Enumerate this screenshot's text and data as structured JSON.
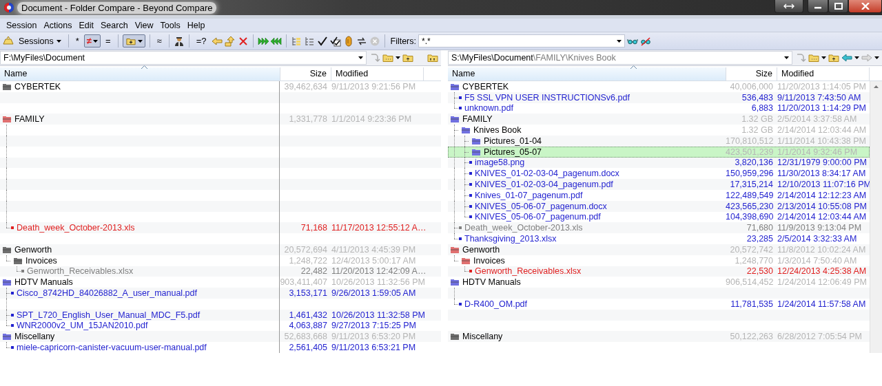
{
  "window": {
    "title": "Document - Folder Compare - Beyond Compare"
  },
  "menu": [
    "Session",
    "Actions",
    "Edit",
    "Search",
    "View",
    "Tools",
    "Help"
  ],
  "toolbar": {
    "sessions": "Sessions",
    "text_buttons": [
      {
        "label": "*",
        "pressed": false
      },
      {
        "label": "≠",
        "pressed": true
      },
      {
        "label": "=",
        "pressed": false
      },
      {
        "label": "≈",
        "pressed": false
      },
      {
        "label": "=?",
        "pressed": false
      }
    ],
    "folder_toggle": {
      "pressed": true
    },
    "filters_label": "Filters:",
    "filter_value": "*.*"
  },
  "left": {
    "path": "F:\\MyFiles\\Document",
    "columns": [
      "Name",
      "Size",
      "Modified"
    ],
    "items": [
      {
        "kind": "folder",
        "name": "CYBERTEK",
        "size": "39,462,634",
        "modified": "9/11/2013 9:21:56 PM",
        "color": "#6e6e6e",
        "selected": false
      },
      {
        "kind": "gap"
      },
      {
        "kind": "gap"
      },
      {
        "kind": "folder",
        "name": "FAMILY",
        "size": "1,331,778",
        "modified": "1/1/2014 9:23:36 PM",
        "color": "#e07070",
        "selected": false,
        "children": [
          {
            "kind": "gap"
          },
          {
            "kind": "gap"
          },
          {
            "kind": "gap"
          },
          {
            "kind": "gap"
          },
          {
            "kind": "gap"
          },
          {
            "kind": "gap"
          },
          {
            "kind": "gap"
          },
          {
            "kind": "gap"
          },
          {
            "kind": "gap"
          },
          {
            "kind": "file",
            "name": "Death_week_October-2013.xls",
            "size": "71,168",
            "modified": "11/17/2013 12:55:12 A…",
            "color": "#e02020",
            "selected": false
          }
        ]
      },
      {
        "kind": "gap"
      },
      {
        "kind": "folder",
        "name": "Genworth",
        "size": "20,572,694",
        "modified": "4/11/2013 4:45:39 PM",
        "color": "#6e6e6e",
        "selected": false,
        "children": [
          {
            "kind": "folder",
            "name": "Invoices",
            "size": "1,248,722",
            "modified": "12/4/2013 5:00:17 AM",
            "color": "#6e6e6e",
            "selected": false,
            "children": [
              {
                "kind": "file",
                "name": "Genworth_Receivables.xlsx",
                "size": "22,482",
                "modified": "11/20/2013 12:42:09 A…",
                "color": "#808080",
                "selected": false
              }
            ]
          }
        ]
      },
      {
        "kind": "folder",
        "name": "HDTV Manuals",
        "size": "903,411,407",
        "modified": "10/26/2013 11:32:56 PM",
        "color": "#7070e0",
        "selected": false,
        "children": [
          {
            "kind": "file",
            "name": "Cisco_8742HD_84026882_A_user_manual.pdf",
            "size": "3,153,171",
            "modified": "9/26/2013 1:59:05 AM",
            "color": "#2323d0",
            "selected": false
          },
          {
            "kind": "gap"
          },
          {
            "kind": "file",
            "name": "SPT_L720_English_User_Manual_MDC_F5.pdf",
            "size": "1,461,432",
            "modified": "10/26/2013 11:32:58 PM",
            "color": "#2323d0",
            "selected": false
          },
          {
            "kind": "file",
            "name": "WNR2000v2_UM_15JAN2010.pdf",
            "size": "4,063,887",
            "modified": "9/27/2013 7:15:25 PM",
            "color": "#2323d0",
            "selected": false
          }
        ]
      },
      {
        "kind": "folder",
        "name": "Miscellany",
        "size": "52,683,668",
        "modified": "9/11/2013 6:53:20 PM",
        "color": "#7070e0",
        "selected": false,
        "children": [
          {
            "kind": "file",
            "name": "miele-capricorn-canister-vacuum-user-manual.pdf",
            "size": "2,561,405",
            "modified": "9/11/2013 6:53:21 PM",
            "color": "#2323d0",
            "selected": false
          }
        ]
      }
    ]
  },
  "right": {
    "path": "S:\\MyFiles\\Document",
    "path_extra": "\\FAMILY\\Knives Book",
    "columns": [
      "Name",
      "Size",
      "Modified"
    ],
    "items": [
      {
        "kind": "folder",
        "name": "CYBERTEK",
        "size": "40,006,000",
        "modified": "11/20/2013 1:14:05 PM",
        "color": "#7070e0",
        "selected": false,
        "children": [
          {
            "kind": "file",
            "name": "F5 SSL VPN USER INSTRUCTIONSv6.pdf",
            "size": "536,483",
            "modified": "9/11/2013 7:43:50 AM",
            "color": "#2323d0",
            "selected": false
          },
          {
            "kind": "file",
            "name": "unknown.pdf",
            "size": "6,883",
            "modified": "11/20/2013 1:14:29 PM",
            "color": "#2323d0",
            "selected": false
          }
        ]
      },
      {
        "kind": "folder",
        "name": "FAMILY",
        "size": "1.32 GB",
        "modified": "2/5/2014 3:37:58 AM",
        "color": "#7070e0",
        "selected": false,
        "children": [
          {
            "kind": "folder",
            "name": "Knives Book",
            "size": "1.32 GB",
            "modified": "2/14/2014 12:03:44 AM",
            "color": "#7070e0",
            "selected": false,
            "children": [
              {
                "kind": "folder",
                "name": "Pictures_01-04",
                "size": "170,810,512",
                "modified": "1/11/2014 10:43:38 PM",
                "color": "#7070e0",
                "selected": false
              },
              {
                "kind": "folder",
                "name": "Pictures_05-07",
                "size": "423,501,239",
                "modified": "1/1/2014 9:32:46 PM",
                "color": "#7070e0",
                "selected": true
              },
              {
                "kind": "file",
                "name": "image58.png",
                "size": "3,820,136",
                "modified": "12/31/1979 9:00:00 PM",
                "color": "#2323d0",
                "selected": false
              },
              {
                "kind": "file",
                "name": "KNIVES_01-02-03-04_pagenum.docx",
                "size": "150,959,296",
                "modified": "11/30/2013 8:34:17 AM",
                "color": "#2323d0",
                "selected": false
              },
              {
                "kind": "file",
                "name": "KNIVES_01-02-03-04_pagenum.pdf",
                "size": "17,315,214",
                "modified": "12/10/2013 11:07:16 PM",
                "color": "#2323d0",
                "selected": false
              },
              {
                "kind": "file",
                "name": "Knives_01-07_pagenum.pdf",
                "size": "122,489,549",
                "modified": "2/14/2014 12:12:23 AM",
                "color": "#2323d0",
                "selected": false
              },
              {
                "kind": "file",
                "name": "KNIVES_05-06-07_pagenum.docx",
                "size": "423,565,230",
                "modified": "2/13/2014 10:55:08 PM",
                "color": "#2323d0",
                "selected": false
              },
              {
                "kind": "file",
                "name": "KNIVES_05-06-07_pagenum.pdf",
                "size": "104,398,690",
                "modified": "2/14/2014 12:03:44 AM",
                "color": "#2323d0",
                "selected": false
              }
            ]
          },
          {
            "kind": "file",
            "name": "Death_week_October-2013.xls",
            "size": "71,680",
            "modified": "11/9/2013 9:13:04 PM",
            "color": "#808080",
            "selected": false
          },
          {
            "kind": "file",
            "name": "Thanksgiving_2013.xlsx",
            "size": "23,285",
            "modified": "2/5/2014 3:32:33 AM",
            "color": "#2323d0",
            "selected": false
          }
        ]
      },
      {
        "kind": "folder",
        "name": "Genworth",
        "size": "20,572,742",
        "modified": "11/8/2012 10:02:24 AM",
        "color": "#e07070",
        "selected": false,
        "children": [
          {
            "kind": "folder",
            "name": "Invoices",
            "size": "1,248,770",
            "modified": "1/3/2014 7:50:40 AM",
            "color": "#e07070",
            "selected": false,
            "children": [
              {
                "kind": "file",
                "name": "Genworth_Receivables.xlsx",
                "size": "22,530",
                "modified": "12/24/2013 4:25:38 AM",
                "color": "#e02020",
                "selected": false
              }
            ]
          }
        ]
      },
      {
        "kind": "folder",
        "name": "HDTV Manuals",
        "size": "906,514,452",
        "modified": "1/24/2014 12:06:49 PM",
        "color": "#7070e0",
        "selected": false,
        "children": [
          {
            "kind": "gap"
          },
          {
            "kind": "file",
            "name": "D-R400_OM.pdf",
            "size": "11,781,535",
            "modified": "1/24/2014 11:57:58 AM",
            "color": "#2323d0",
            "selected": false
          }
        ]
      },
      {
        "kind": "gap"
      },
      {
        "kind": "gap"
      },
      {
        "kind": "folder",
        "name": "Miscellany",
        "size": "50,122,263",
        "modified": "6/28/2012 7:05:54 PM",
        "color": "#6e6e6e",
        "selected": false
      }
    ]
  }
}
